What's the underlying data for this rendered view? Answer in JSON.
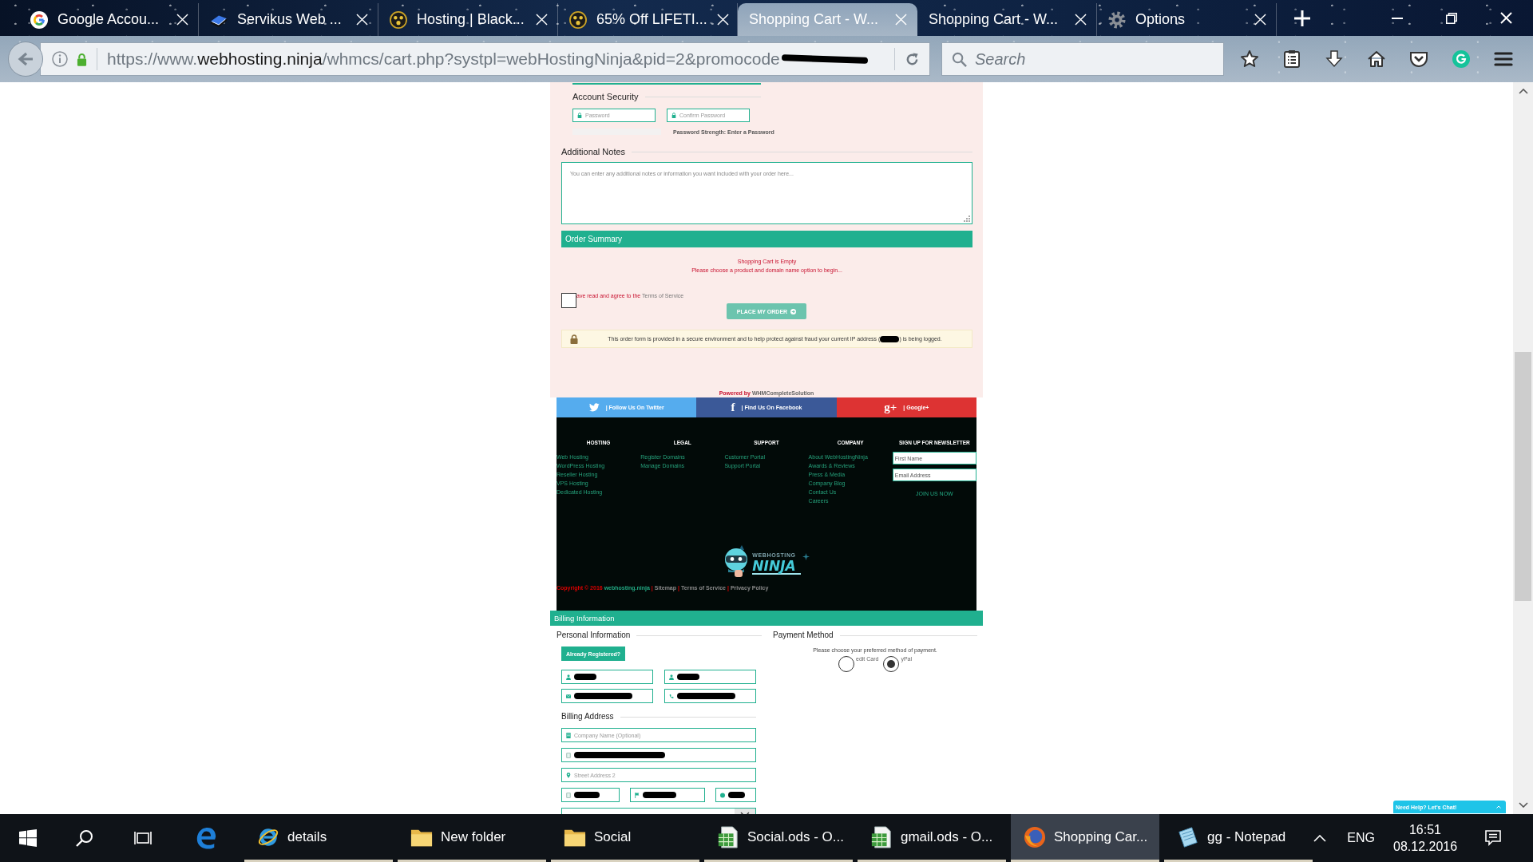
{
  "browser": {
    "tabs": [
      {
        "title": "Google Accou...",
        "kind": "google",
        "selected": false
      },
      {
        "title": "Servikus Web ...",
        "kind": "book",
        "selected": false
      },
      {
        "title": "Hosting | Black...",
        "kind": "badge",
        "selected": false
      },
      {
        "title": "65% Off LIFETI...",
        "kind": "badge",
        "selected": false
      },
      {
        "title": "Shopping Cart - W...",
        "selected": true
      },
      {
        "title": "Shopping Cart - W...",
        "selected": false
      },
      {
        "title": "Options",
        "kind": "gear",
        "selected": false
      }
    ],
    "url": {
      "scheme": "https://www.",
      "domain": "webhosting.ninja",
      "path": "/whmcs/cart.php?systpl=webHostingNinja&pid=2&promocode",
      "redacted": true
    },
    "search": {
      "placeholder": "Search"
    }
  },
  "page": {
    "account_security": {
      "heading": "Account Security",
      "fields": [
        {
          "placeholder": "Password"
        },
        {
          "placeholder": "Confirm Password"
        }
      ],
      "strength": "Password Strength: Enter a Password"
    },
    "additional_notes": {
      "heading": "Additional Notes",
      "placeholder": "You can enter any additional notes or information you want included with your order here..."
    },
    "order_summary": {
      "title": "Order Summary",
      "messages": [
        "Shopping Cart is Empty",
        "Please choose a product and domain name option to begin..."
      ]
    },
    "terms": {
      "checked": false,
      "text": "ave read and agree to the",
      "link": "Terms of Service"
    },
    "place_order": {
      "label": "PLACE MY ORDER"
    },
    "secure_notice": {
      "before": "This order form is provided in a secure environment and to help protect against fraud your current IP address (",
      "after": ") is being logged.",
      "redacted": true
    },
    "powered_by": {
      "label": "Powered by",
      "link": "WHMCompleteSolution"
    },
    "social": [
      {
        "kind": "twitter",
        "label": "| Follow Us On Twitter"
      },
      {
        "kind": "facebook",
        "glyph": "f",
        "label": "| Find Us On Facebook"
      },
      {
        "kind": "google",
        "glyph": "g+",
        "label": "| Google+"
      }
    ],
    "footer": {
      "columns": [
        {
          "heading": "HOSTING",
          "links": [
            "Web Hosting",
            "WordPress Hosting",
            "Reseller Hosting",
            "VPS Hosting",
            "Dedicated Hosting"
          ]
        },
        {
          "heading": "LEGAL",
          "links": [
            "Register Domains",
            "Manage Domains"
          ]
        },
        {
          "heading": "SUPPORT",
          "links": [
            "Customer Portal",
            "Support Portal"
          ]
        },
        {
          "heading": "COMPANY",
          "links": [
            "About WebHostingNinja",
            "Awards & Reviews",
            "Press & Media",
            "Company Blog",
            "Contact Us",
            "Careers"
          ]
        }
      ],
      "newsletter": {
        "heading": "SIGN UP FOR NEWSLETTER",
        "fields": [
          {
            "placeholder": "First Name"
          },
          {
            "placeholder": "Email Address"
          }
        ],
        "button": "JOIN US NOW"
      },
      "logo": {
        "tagline": "WEBHOSTING",
        "wordmark": "NINJA"
      },
      "copyright": [
        {
          "kind": "notice",
          "text": "Copyright © 2016"
        },
        {
          "kind": "site",
          "text": "webhosting.ninja"
        },
        {
          "kind": "separator",
          "text": "|"
        },
        {
          "kind": "link",
          "text": "Sitemap"
        },
        {
          "kind": "separator",
          "text": "|"
        },
        {
          "kind": "link",
          "text": "Terms of Service"
        },
        {
          "kind": "separator",
          "text": "|"
        },
        {
          "kind": "link",
          "text": "Privacy Policy"
        }
      ]
    },
    "billing": {
      "title": "Billing Information",
      "personal": {
        "heading": "Personal Information",
        "login_button": "Already Registered?",
        "fields": [
          {
            "kind": "person",
            "redacted": true
          },
          {
            "kind": "person",
            "redacted": true
          },
          {
            "kind": "envelope",
            "redacted": true
          },
          {
            "kind": "phone",
            "redacted": true
          }
        ]
      },
      "address": {
        "heading": "Billing Address",
        "rows": [
          [
            {
              "kind": "building",
              "placeholder": "Company Name (Optional)",
              "redacted": false
            }
          ],
          [
            {
              "kind": "tablet",
              "redacted": true
            }
          ],
          [
            {
              "kind": "pin",
              "placeholder": "Street Address 2",
              "redacted": false
            }
          ],
          [
            {
              "kind": "tablet",
              "redacted": true
            },
            {
              "kind": "flag",
              "redacted": true
            },
            {
              "kind": "dot",
              "redacted": true
            }
          ],
          [
            {
              "kind": "select"
            }
          ]
        ]
      },
      "payment": {
        "heading": "Payment Method",
        "hint": "Please choose your preferred method of payment.",
        "options": [
          {
            "label": "edit Card",
            "selected": false
          },
          {
            "label": "yPal",
            "selected": true
          }
        ]
      }
    }
  },
  "chat": {
    "label": "Need Help? Let's Chat!"
  },
  "taskbar": {
    "apps": [
      {
        "kind": "ie",
        "label": "details",
        "selected": false
      },
      {
        "kind": "folder",
        "label": "New folder",
        "selected": false
      },
      {
        "kind": "folder",
        "label": "Social",
        "selected": false
      },
      {
        "kind": "sheet",
        "label": "Social.ods - O...",
        "selected": false
      },
      {
        "kind": "sheet",
        "label": "gmail.ods - O...",
        "selected": false
      },
      {
        "kind": "firefox",
        "label": "Shopping Car...",
        "selected": true
      },
      {
        "kind": "notepad",
        "label": "gg - Notepad",
        "selected": false
      }
    ],
    "tray": {
      "language": "ENG",
      "time": "16:51",
      "date": "08.12.2016"
    }
  }
}
